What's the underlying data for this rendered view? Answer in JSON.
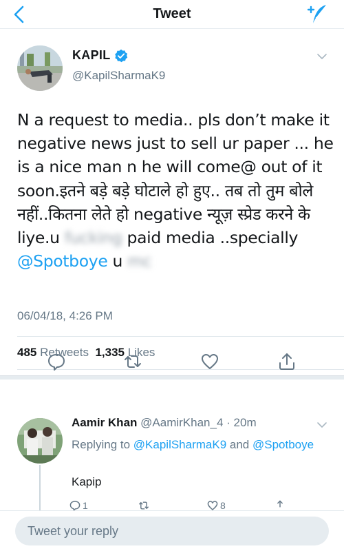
{
  "header": {
    "title": "Tweet",
    "back_icon": "chevron-left-icon",
    "compose_icon": "compose-tweet-icon"
  },
  "tweet": {
    "author_name": "KAPIL",
    "handle": "@KapilSharmaK9",
    "verified": true,
    "text_part1": "N a request to media.. pls don’t make it negative news just to sell ur paper ... he is a nice man n he will come@ out of it soon.इतने बड़े बड़े घोटाले हो हुए.. तब तो तुम बोले नहीं..कितना लेते हो negative न्यूज़ स्प्रेड करने के liye.u ",
    "text_blurred1": "fucking",
    "text_part2": " paid media ..specially ",
    "mention": "@Spotboye",
    "text_part3": " u ",
    "text_blurred2": "mc",
    "date": "06/04/18, 4:26 PM",
    "retweet_count": "485",
    "retweet_label": "Retweets",
    "like_count": "1,335",
    "like_label": "Likes"
  },
  "reply": {
    "author_name": "Aamir Khan",
    "handle": "@AamirKhan_4",
    "time": "20m",
    "replying_prefix": "Replying to ",
    "replying_to_1": "@KapilSharmaK9",
    "replying_and": " and ",
    "replying_to_2": "@Spotboye",
    "text": "Kapip",
    "reply_count": "1",
    "like_count": "8"
  },
  "composer": {
    "placeholder": "Tweet your reply"
  },
  "colors": {
    "accent": "#1da1f2",
    "text_primary": "#14171a",
    "text_secondary": "#657786",
    "divider": "#e1e8ed"
  }
}
